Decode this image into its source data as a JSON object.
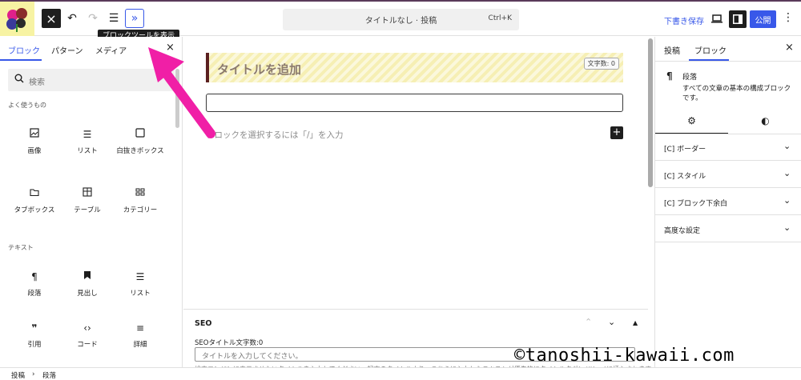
{
  "topbar": {
    "add_label": "×",
    "doc_title": "タイトルなし · 投稿",
    "shortcut": "Ctrl+K",
    "save_draft": "下書き保存",
    "publish": "公開",
    "tooltip": "ブロックツールを表示"
  },
  "left": {
    "tabs": [
      "ブロック",
      "パターン",
      "メディア"
    ],
    "close": "×",
    "search_placeholder": "検索",
    "sections": [
      {
        "label": "よく使うもの"
      },
      {
        "label": "テキスト"
      }
    ],
    "frequent": [
      {
        "label": "画像",
        "icon": "image-icon"
      },
      {
        "label": "リスト",
        "icon": "list-icon"
      },
      {
        "label": "白抜きボックス",
        "icon": "box-icon"
      },
      {
        "label": "タブボックス",
        "icon": "folder-icon"
      },
      {
        "label": "テーブル",
        "icon": "table-icon"
      },
      {
        "label": "カテゴリー",
        "icon": "category-icon"
      }
    ],
    "text_blocks": [
      {
        "label": "段落",
        "icon": "paragraph-icon"
      },
      {
        "label": "見出し",
        "icon": "bookmark-icon"
      },
      {
        "label": "リスト",
        "icon": "list-icon"
      },
      {
        "label": "引用",
        "icon": "quote-icon"
      },
      {
        "label": "コード",
        "icon": "code-icon"
      },
      {
        "label": "詳細",
        "icon": "details-icon"
      }
    ]
  },
  "canvas": {
    "title_placeholder": "タイトルを追加",
    "char_count": "文字数: 0",
    "block_placeholder": "ブロックを選択するには「/」を入力",
    "seo": {
      "title": "SEO",
      "field_label": "SEOタイトル文字数:0",
      "input_placeholder": "タイトルを入力してください。",
      "help": "検索エンジンに表示させたいタイトルを入力してください。記事のタイトルより、こちらに入力したテキストが優先的にタイトルタグ(<title>)に挿入されます。"
    }
  },
  "right": {
    "tabs": [
      "投稿",
      "ブロック"
    ],
    "close": "×",
    "block_name": "段落",
    "block_desc": "すべての文章の基本の構成ブロックです。",
    "sections": [
      "[C] ボーダー",
      "[C] スタイル",
      "[C] ブロック下余白",
      "高度な設定"
    ]
  },
  "breadcrumb": [
    "投稿",
    "段落"
  ],
  "watermark": "©tanoshii-kawaii.com",
  "colors": {
    "accent": "#3858e9",
    "arrow": "#f01fa6",
    "title_border": "#5b2020"
  }
}
